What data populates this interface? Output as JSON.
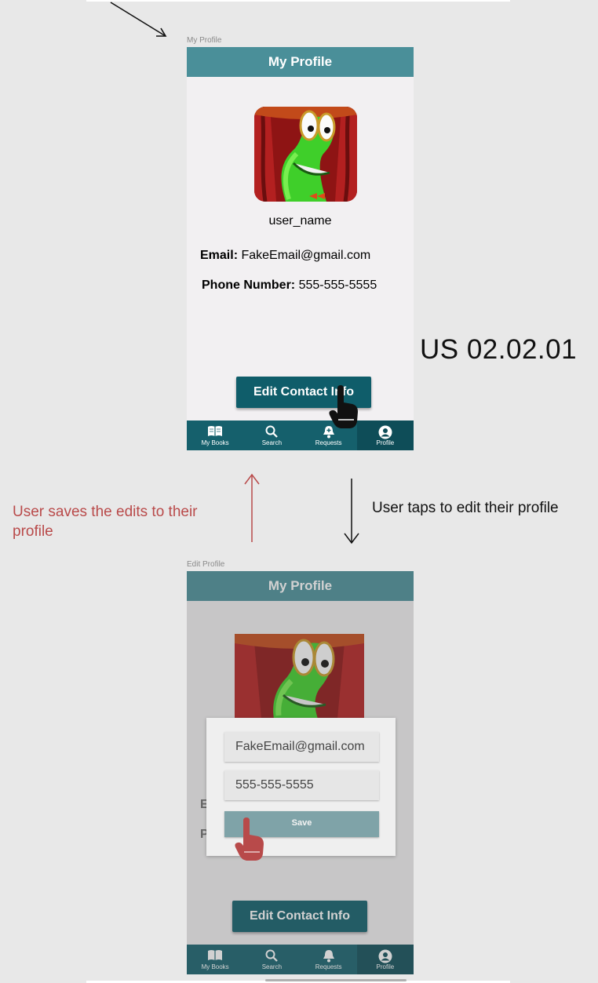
{
  "top_screen": {
    "caption": "My Profile",
    "app_title": "My Profile",
    "username": "user_name",
    "email_label": "Email:",
    "email_value": "FakeEmail@gmail.com",
    "phone_label": "Phone Number:",
    "phone_value": "555-555-5555",
    "edit_button": "Edit Contact Info",
    "nav": [
      {
        "label": "My Books",
        "icon": "book-icon"
      },
      {
        "label": "Search",
        "icon": "search-icon"
      },
      {
        "label": "Requests",
        "icon": "bell-icon"
      },
      {
        "label": "Profile",
        "icon": "profile-icon"
      }
    ],
    "active_tab": "Profile"
  },
  "bottom_screen": {
    "caption": "Edit Profile",
    "app_title": "My Profile",
    "dialog": {
      "email_value": "FakeEmail@gmail.com",
      "phone_value": "555-555-5555",
      "save_label": "Save"
    },
    "edit_button": "Edit Contact Info",
    "partial_letters": [
      "E",
      "P"
    ],
    "nav": [
      {
        "label": "My Books",
        "icon": "book-icon"
      },
      {
        "label": "Search",
        "icon": "search-icon"
      },
      {
        "label": "Requests",
        "icon": "bell-icon"
      },
      {
        "label": "Profile",
        "icon": "profile-icon"
      }
    ]
  },
  "annotations": {
    "user_story": "US 02.02.01",
    "tap_note": "User taps to edit their profile",
    "save_note": "User saves the edits to their profile"
  },
  "colors": {
    "appbar": "#4a8f99",
    "navbar": "#15606c",
    "button": "#0f5d6a",
    "save_note": "#b94a4a"
  }
}
